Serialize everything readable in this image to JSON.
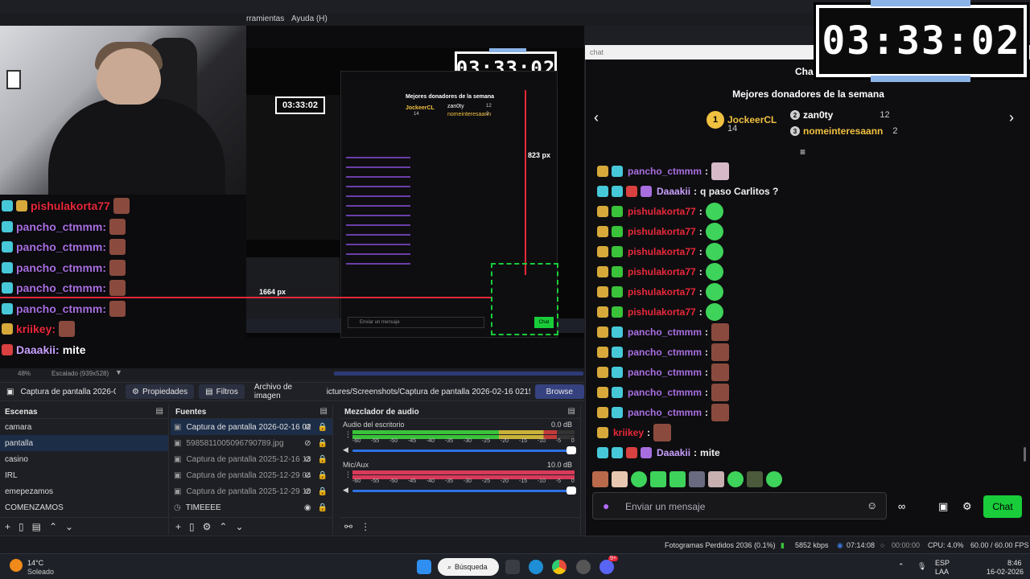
{
  "obs": {
    "menu": {
      "tools": "rramientas",
      "help": "Ayuda (H)"
    },
    "preview": {
      "overlay_chat": [
        {
          "user": "pishulakorta77",
          "color": "#e8283a",
          "badges": [
            "cyan",
            "gold"
          ]
        },
        {
          "user": "pancho_ctmmm:",
          "color": "#a86ee0",
          "badges": [
            "cyan"
          ]
        },
        {
          "user": "pancho_ctmmm:",
          "color": "#a86ee0",
          "badges": [
            "cyan"
          ]
        },
        {
          "user": "pancho_ctmmm:",
          "color": "#a86ee0",
          "badges": [
            "cyan"
          ]
        },
        {
          "user": "pancho_ctmmm:",
          "color": "#a86ee0",
          "badges": [
            "cyan"
          ]
        },
        {
          "user": "pancho_ctmmm:",
          "color": "#a86ee0",
          "badges": [
            "cyan"
          ]
        },
        {
          "user": "kriikey:",
          "color": "#e8283a",
          "badges": [
            "gold"
          ]
        },
        {
          "user": "Daaakii:",
          "color": "#c9a0ff",
          "badges": [
            "red"
          ],
          "text": "mite"
        }
      ],
      "clock_small": "03:33:02",
      "clock_tiny": "03:33:02",
      "px_vertical": "823 px",
      "px_horizontal": "1664 px",
      "inner_chat_title": "Mejores donadores de la semana",
      "inner_top1": "JockeerCL",
      "inner_top1_count": "14",
      "inner_top2": "zan0ty",
      "inner_top2_count": "12",
      "inner_top3": "nomeinteresaann",
      "inner_top3_count": "2",
      "inner_input": "Enviar un mensaje",
      "inner_chat_btn": "Chat"
    },
    "zoom": "48%",
    "scaled": "Escalado (939x528)",
    "props_bar": {
      "source_name": "Captura de pantalla 2026-0",
      "properties": "Propiedades",
      "filters": "Filtros",
      "image_label": "Archivo de imagen",
      "path": "ictures/Screenshots/Captura de pantalla 2026-02-16 021529.png",
      "browse": "Browse"
    },
    "scenes": {
      "title": "Escenas",
      "items": [
        "camara",
        "pantalla",
        "casino",
        "IRL",
        "emepezamos",
        "COMENZAMOS"
      ],
      "selected": 1
    },
    "sources": {
      "title": "Fuentes",
      "items": [
        "Captura de pantalla 2026-02-16 02",
        "5985811005096790789.jpg",
        "Captura de pantalla 2025-12-16 13",
        "Captura de pantalla 2025-12-29 04",
        "Captura de pantalla 2025-12-29 10",
        "TIMEEEE"
      ]
    },
    "mixer": {
      "title": "Mezclador de audio",
      "channels": [
        {
          "name": "Audio del escritorio",
          "db": "0.0 dB",
          "level": 0.92,
          "color": "green"
        },
        {
          "name": "Mic/Aux",
          "db": "10.0 dB",
          "level": 1.0,
          "color": "red"
        }
      ],
      "scale": [
        "-60",
        "-55",
        "-50",
        "-45",
        "-40",
        "-35",
        "-30",
        "-25",
        "-20",
        "-15",
        "-10",
        "-5",
        "0"
      ]
    },
    "status": {
      "frames": "Fotogramas Perdidos 2036 (0.1%)",
      "kbps": "5852 kbps",
      "live_time": "07:14:08",
      "rec_time": "00:00:00",
      "cpu": "CPU: 4.0%",
      "fps": "60.00 / 60.00 FPS"
    }
  },
  "chat": {
    "tab_label": "chat",
    "header": "Cha",
    "title": "Mejores donadores de la semana",
    "donors": [
      {
        "rank": "1",
        "name": "JockeerCL",
        "count": "14",
        "color": "#f0c040"
      },
      {
        "rank": "2",
        "name": "zan0ty",
        "count": "12",
        "color": "#ffffff"
      },
      {
        "rank": "3",
        "name": "nomeinteresaann",
        "count": "2",
        "color": "#f0c040"
      }
    ],
    "messages": [
      {
        "user": "pancho_ctmmm",
        "color": "#a86ee0",
        "badges": [
          "gold",
          "cyan"
        ],
        "emote": "pink"
      },
      {
        "user": "Daaakii",
        "color": "#c9a0ff",
        "badges": [
          "cyan",
          "cyan",
          "red",
          "purple"
        ],
        "text": "q paso Carlitos ?"
      },
      {
        "user": "pishulakorta77",
        "color": "#e8283a",
        "badges": [
          "gold",
          "green"
        ],
        "emote": "green"
      },
      {
        "user": "pishulakorta77",
        "color": "#e8283a",
        "badges": [
          "gold",
          "green"
        ],
        "emote": "green"
      },
      {
        "user": "pishulakorta77",
        "color": "#e8283a",
        "badges": [
          "gold",
          "green"
        ],
        "emote": "green"
      },
      {
        "user": "pishulakorta77",
        "color": "#e8283a",
        "badges": [
          "gold",
          "green"
        ],
        "emote": "green"
      },
      {
        "user": "pishulakorta77",
        "color": "#e8283a",
        "badges": [
          "gold",
          "green"
        ],
        "emote": "green"
      },
      {
        "user": "pishulakorta77",
        "color": "#e8283a",
        "badges": [
          "gold",
          "green"
        ],
        "emote": "green"
      },
      {
        "user": "pancho_ctmmm",
        "color": "#a86ee0",
        "badges": [
          "gold",
          "cyan"
        ],
        "emote": "brown"
      },
      {
        "user": "pancho_ctmmm",
        "color": "#a86ee0",
        "badges": [
          "gold",
          "cyan"
        ],
        "emote": "brown"
      },
      {
        "user": "pancho_ctmmm",
        "color": "#a86ee0",
        "badges": [
          "gold",
          "cyan"
        ],
        "emote": "brown"
      },
      {
        "user": "pancho_ctmmm",
        "color": "#a86ee0",
        "badges": [
          "gold",
          "cyan"
        ],
        "emote": "brown"
      },
      {
        "user": "pancho_ctmmm",
        "color": "#a86ee0",
        "badges": [
          "gold",
          "cyan"
        ],
        "emote": "brown"
      },
      {
        "user": "kriikey",
        "color": "#e8283a",
        "badges": [
          "gold"
        ],
        "emote": "brown"
      },
      {
        "user": "Daaakii",
        "color": "#c9a0ff",
        "badges": [
          "cyan",
          "cyan",
          "red",
          "purple"
        ],
        "text": "mite"
      }
    ],
    "input_placeholder": "Enviar un mensaje",
    "chat_button": "Chat"
  },
  "stream_clock": "03:33:02",
  "taskbar": {
    "weather_temp": "14°C",
    "weather_text": "Soleado",
    "search": "Búsqueda",
    "lang1": "ESP",
    "lang2": "LAA",
    "time": "8:46",
    "date": "16-02-2026",
    "discord_badge": "9+"
  }
}
